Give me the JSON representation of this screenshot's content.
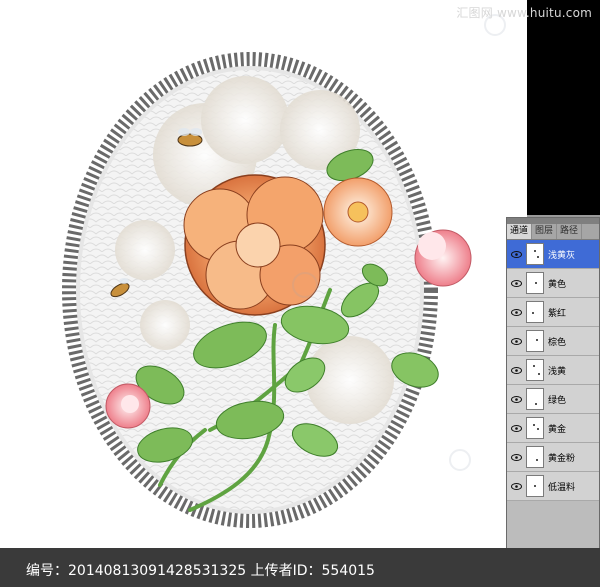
{
  "watermark": {
    "text": "汇图网 www.huitu.com"
  },
  "status_bar": {
    "text": "编号：20140813091428531325 上传者ID：554015"
  },
  "channels_panel": {
    "tabs": [
      "通道",
      "图层",
      "路径"
    ],
    "active_tab_index": 0,
    "channels": [
      {
        "label": "浅黄灰",
        "selected": true
      },
      {
        "label": "黄色",
        "selected": false
      },
      {
        "label": "紫红",
        "selected": false
      },
      {
        "label": "棕色",
        "selected": false
      },
      {
        "label": "浅黄",
        "selected": false
      },
      {
        "label": "绿色",
        "selected": false
      },
      {
        "label": "黄金",
        "selected": false
      },
      {
        "label": "黄金粉",
        "selected": false
      },
      {
        "label": "低温料",
        "selected": false
      }
    ]
  },
  "colors": {
    "selection": "#3f6bd6",
    "panel_bg": "#c9c9c9",
    "status_bar_bg": "#3a3a3a",
    "frame": "#555555"
  },
  "icons": [
    "eye-icon",
    "bee-icon",
    "flower-icon"
  ]
}
